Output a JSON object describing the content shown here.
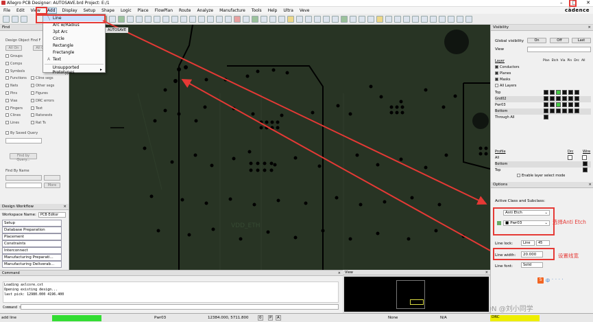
{
  "window": {
    "title": "Allegro PCB Designer: AUTOSAVE.brd  Project: E:/1",
    "brand": "cādence"
  },
  "menu": [
    "File",
    "Edit",
    "View",
    "Add",
    "Display",
    "Setup",
    "Shape",
    "Logic",
    "Place",
    "FlowPlan",
    "Route",
    "Analyze",
    "Manufacture",
    "Tools",
    "Help",
    "Ultra",
    "Veve"
  ],
  "add_menu": {
    "items": [
      "Line",
      "Arc w/Radius",
      "3pt Arc",
      "Circle",
      "Rectangle",
      "Frectangle",
      "Text"
    ],
    "footer": "Unsupported Prototypes",
    "footer_arrow": "▸"
  },
  "tab": "AUTOSAVE",
  "find": {
    "title": "Find",
    "design_object_label": "Design Object Find F",
    "all_on": "All On",
    "all_off": "All Off",
    "left": [
      "Groups",
      "Comps",
      "Symbols",
      "Functions",
      "Nets",
      "Pins",
      "Vias",
      "Fingers",
      "Clines",
      "Lines"
    ],
    "right": [
      "",
      "",
      "",
      "Cline segs",
      "Other segs",
      "Figures",
      "DRC errors",
      "Text",
      "Ratsnests",
      "Rat Ts"
    ],
    "by_saved_query": "By Saved Query",
    "find_by_query": "Find by Query...",
    "find_by_name": "Find By Name",
    "more": "More"
  },
  "workflow": {
    "title": "Design Workflow",
    "workspace_label": "Workspace Name:",
    "workspace_value": "PCB Editor",
    "items": [
      "Setup",
      "Database Preparation",
      "Placement",
      "Constraints",
      "Interconnect",
      "Manufacturing Preparati...",
      "Manufacturing Deliverab..."
    ]
  },
  "visibility": {
    "title": "Visibility",
    "global": "Global visibility",
    "on": "On",
    "off": "Off",
    "last": "Last",
    "view_label": "View",
    "headers": [
      "Plan",
      "Etch",
      "Via",
      "Pin",
      "Drc",
      "All"
    ],
    "layers_label": "Layer",
    "layer_checks": [
      "Conductors",
      "Planes",
      "Masks",
      "All Layers"
    ],
    "rows": [
      "Top",
      "Gnd02",
      "Pwr03",
      "Bottom",
      "Through All"
    ],
    "profile_label": "Profile",
    "profile_headers": [
      "Drc",
      "Wire"
    ],
    "profile_rows": [
      "All",
      "Bottom",
      "Top"
    ],
    "enable_layer_select": "Enable layer select mode"
  },
  "options": {
    "title": "Options",
    "active_class_label": "Active Class and Subclass:",
    "class_value": "Anti Etch",
    "subclass_value": "Pwr03",
    "line_lock_label": "Line lock:",
    "line_lock_value": "Line",
    "line_angle": "45",
    "line_width_label": "Line width:",
    "line_width_value": "20.000",
    "line_font_label": "Line font:",
    "line_font_value": "Solid"
  },
  "annotations": {
    "select_anti_etch": "选择Anti Etch",
    "set_line_width": "设置线宽"
  },
  "command": {
    "title": "Command",
    "log": [
      "Loading axlcore.cxt",
      "Opening existing design...",
      "last pick:  12980.000 4196.400"
    ],
    "prompt": "Command >"
  },
  "view": {
    "title": "View"
  },
  "canvas": {
    "net_label": "VDD_ETH"
  },
  "status": {
    "command": "add line",
    "layer": "Pwr03",
    "coords": "12384.000, 5711.800",
    "btn_p": "P",
    "btn_a": "A",
    "mode": "None",
    "na": "N/A",
    "drc": "DRC",
    "pill": "0"
  },
  "ime": {
    "chars": [
      "中",
      "·",
      "·",
      "·",
      "·"
    ]
  },
  "watermark": "CSDN @刘小同学",
  "colors": {
    "canvas": "#283424",
    "status_green": "#33dd33",
    "status_yellow": "#eeee00",
    "accent_red": "#e53935"
  }
}
